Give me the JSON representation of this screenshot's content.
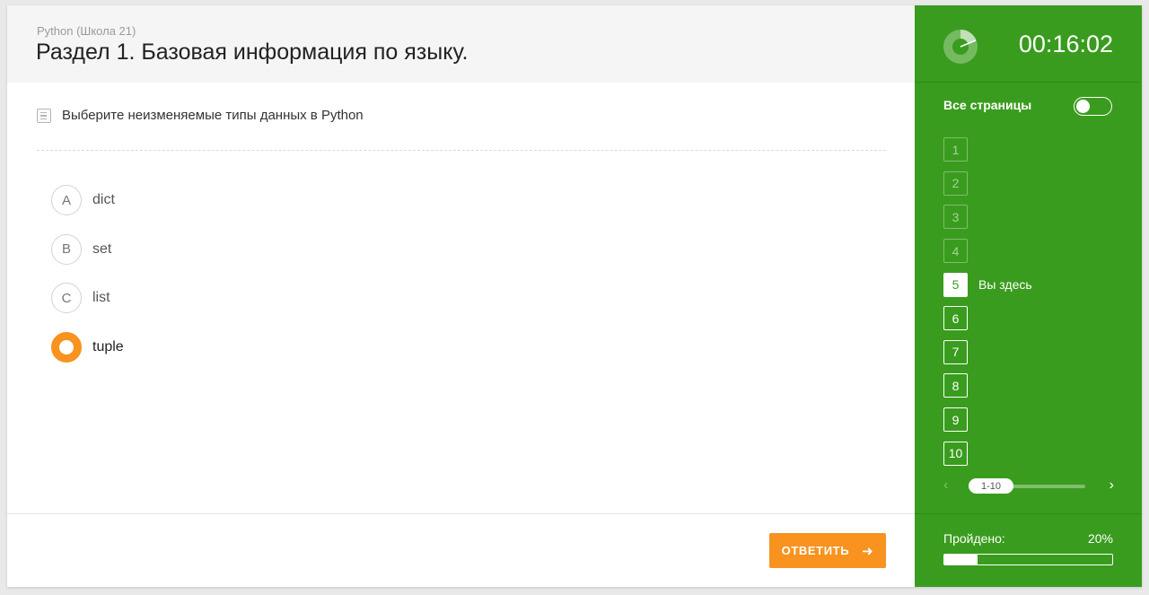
{
  "header": {
    "course": "Python (Школа 21)",
    "section_title": "Раздел 1. Базовая информация по языку."
  },
  "question": {
    "text": "Выберите неизменяемые типы данных в Python",
    "icon": "document-icon"
  },
  "options": [
    {
      "letter": "A",
      "label": "dict",
      "selected": false
    },
    {
      "letter": "B",
      "label": "set",
      "selected": false
    },
    {
      "letter": "C",
      "label": "list",
      "selected": false
    },
    {
      "letter": "",
      "label": "tuple",
      "selected": true
    }
  ],
  "answer_button": {
    "label": "ОТВЕТИТЬ",
    "icon": "arrow-right-icon"
  },
  "sidebar": {
    "timer": "00:16:02",
    "timer_icon": "timer-pie-icon",
    "all_pages_label": "Все страницы",
    "all_pages_enabled": false,
    "pages": [
      {
        "num": "1",
        "state": "done"
      },
      {
        "num": "2",
        "state": "done"
      },
      {
        "num": "3",
        "state": "done"
      },
      {
        "num": "4",
        "state": "done"
      },
      {
        "num": "5",
        "state": "current",
        "note": "Вы здесь"
      },
      {
        "num": "6",
        "state": "todo"
      },
      {
        "num": "7",
        "state": "todo"
      },
      {
        "num": "8",
        "state": "todo"
      },
      {
        "num": "9",
        "state": "todo"
      },
      {
        "num": "10",
        "state": "todo"
      }
    ],
    "pager_range": "1-10",
    "passed_label": "Пройдено:",
    "passed_percent": "20%",
    "passed_fraction": 0.2
  },
  "colors": {
    "accent_orange": "#f7931e",
    "sidebar_green": "#3a9c1e"
  }
}
